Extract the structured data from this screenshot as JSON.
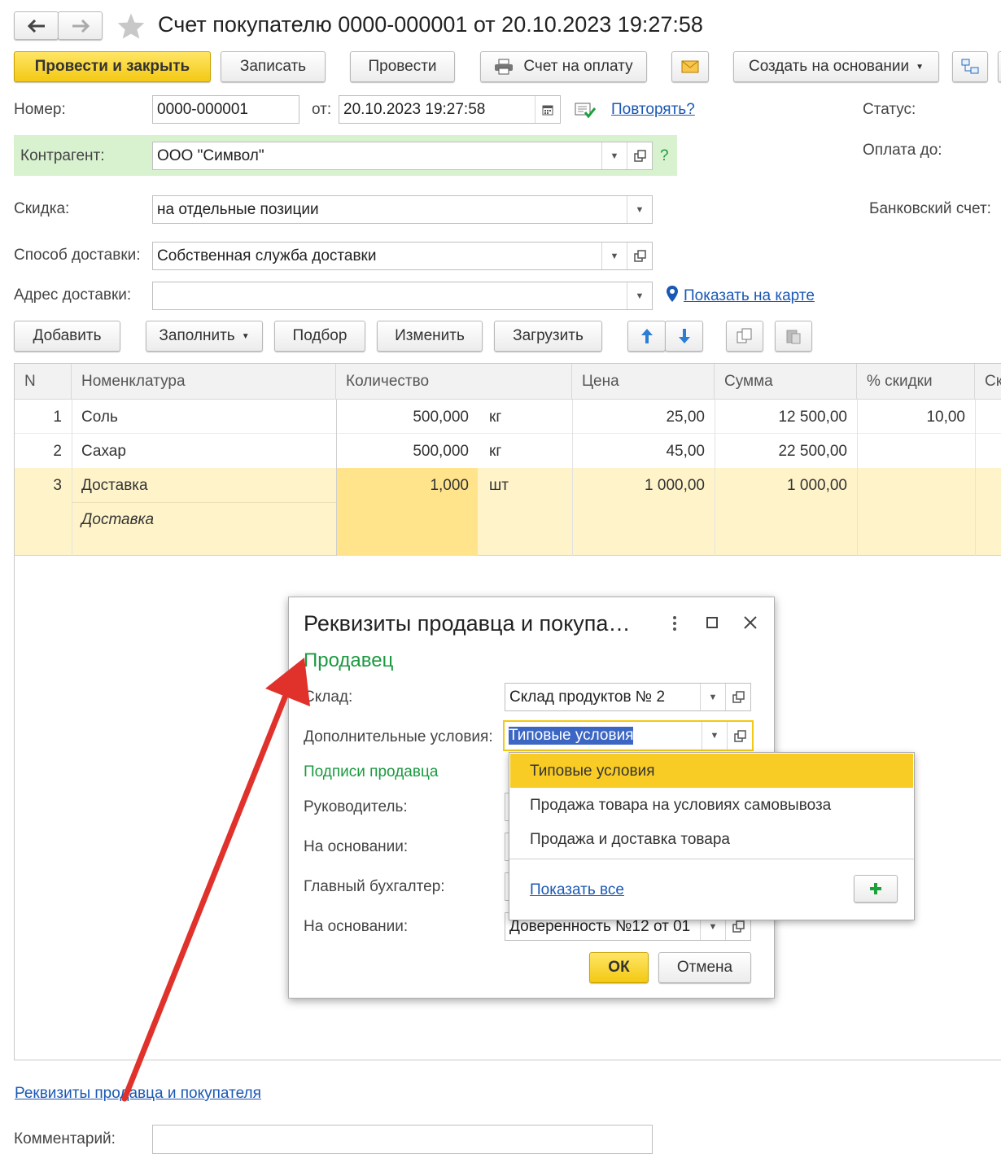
{
  "window": {
    "title": "Счет покупателю 0000-000001 от 20.10.2023 19:27:58",
    "nav_back_icon": "arrow-left-icon",
    "nav_forward_icon": "arrow-right-icon",
    "favorite_icon": "star-icon"
  },
  "toolbar": {
    "post_close": "Провести и закрыть",
    "save": "Записать",
    "post": "Провести",
    "invoice": "Счет на оплату",
    "create_based": "Создать на основании"
  },
  "form": {
    "number_label": "Номер:",
    "number_value": "0000-000001",
    "date_label": "от:",
    "date_value": "20.10.2023 19:27:58",
    "repeat_link": "Повторять?",
    "status_label": "Статус:",
    "counterparty_label": "Контрагент:",
    "counterparty_value": "ООО \"Символ\"",
    "help_mark": "?",
    "pay_until_label": "Оплата до:",
    "discount_label": "Скидка:",
    "discount_value": "на отдельные позиции",
    "bank_account_label": "Банковский счет:",
    "delivery_method_label": "Способ доставки:",
    "delivery_method_value": "Собственная служба доставки",
    "delivery_address_label": "Адрес доставки:",
    "delivery_address_value": "",
    "show_on_map": "Показать на карте"
  },
  "table_toolbar": {
    "add": "Добавить",
    "fill": "Заполнить",
    "pick": "Подбор",
    "change": "Изменить",
    "load": "Загрузить"
  },
  "table": {
    "headers": [
      "N",
      "Номенклатура",
      "Количество",
      "Цена",
      "Сумма",
      "% скидки",
      "Ск"
    ],
    "rows": [
      {
        "n": "1",
        "name": "Соль",
        "qty": "500,000",
        "unit": "кг",
        "price": "25,00",
        "sum": "12 500,00",
        "discount": "10,00",
        "sub": ""
      },
      {
        "n": "2",
        "name": "Сахар",
        "qty": "500,000",
        "unit": "кг",
        "price": "45,00",
        "sum": "22 500,00",
        "discount": "",
        "sub": ""
      },
      {
        "n": "3",
        "name": "Доставка",
        "qty": "1,000",
        "unit": "шт",
        "price": "1 000,00",
        "sum": "1 000,00",
        "discount": "",
        "sub": "Доставка"
      }
    ]
  },
  "dialog": {
    "title": "Реквизиты продавца и покупа…",
    "section_seller": "Продавец",
    "warehouse_label": "Склад:",
    "warehouse_value": "Склад продуктов № 2",
    "conditions_label": "Дополнительные условия:",
    "conditions_value": "Типовые условия",
    "signatures_label": "Подписи продавца",
    "head_label": "Руководитель:",
    "basis_label_1": "На основании:",
    "accountant_label": "Главный бухгалтер:",
    "basis_label_2": "На основании:",
    "basis_value_2": "Доверенность №12 от 01",
    "ok": "ОК",
    "cancel": "Отмена"
  },
  "dropdown": {
    "options": [
      "Типовые условия",
      "Продажа товара на условиях самовывоза",
      "Продажа и доставка товара"
    ],
    "show_all": "Показать все"
  },
  "footer": {
    "requisites_link": "Реквизиты продавца и покупателя",
    "comment_label": "Комментарий:",
    "comment_value": ""
  },
  "colors": {
    "accent_yellow": "#f3c913",
    "highlight_row": "#fff4c9",
    "counterparty_bg": "#d8f1cf",
    "green_heading": "#1c9a40",
    "link_blue": "#1a58b5",
    "arrow_red": "#e0312b"
  }
}
